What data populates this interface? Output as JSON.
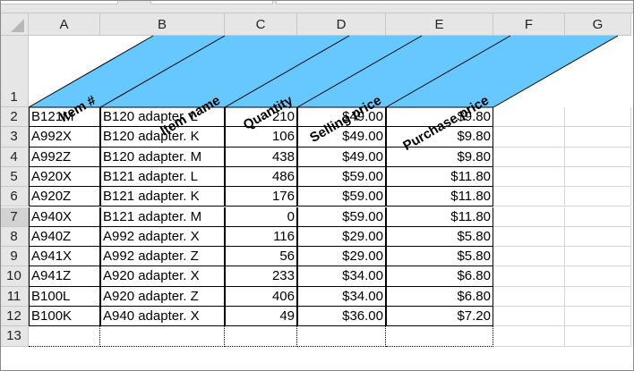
{
  "columns": [
    "A",
    "B",
    "C",
    "D",
    "E",
    "F",
    "G"
  ],
  "rows": [
    "1",
    "2",
    "3",
    "4",
    "5",
    "6",
    "7",
    "8",
    "9",
    "10",
    "11",
    "12",
    "13"
  ],
  "headers": [
    "Item #",
    "Item name",
    "Quantity",
    "Selling price",
    "Purchase price"
  ],
  "header_fill": "#66c8ff",
  "data": [
    [
      "B121M",
      "B120 adapter. L",
      "210",
      "$49.00",
      "$9.80"
    ],
    [
      "A992X",
      "B120 adapter. K",
      "106",
      "$49.00",
      "$9.80"
    ],
    [
      "A992Z",
      "B120 adapter. M",
      "438",
      "$49.00",
      "$9.80"
    ],
    [
      "A920X",
      "B121 adapter. L",
      "486",
      "$59.00",
      "$11.80"
    ],
    [
      "A920Z",
      "B121 adapter. K",
      "176",
      "$59.00",
      "$11.80"
    ],
    [
      "A940X",
      "B121 adapter. M",
      "0",
      "$59.00",
      "$11.80"
    ],
    [
      "A940Z",
      "A992 adapter. X",
      "116",
      "$29.00",
      "$5.80"
    ],
    [
      "A941X",
      "A992 adapter. Z",
      "56",
      "$29.00",
      "$5.80"
    ],
    [
      "A941Z",
      "A920 adapter. X",
      "233",
      "$34.00",
      "$6.80"
    ],
    [
      "B100L",
      "A920 adapter. Z",
      "406",
      "$34.00",
      "$6.80"
    ],
    [
      "B100K",
      "A940 adapter. X",
      "49",
      "$36.00",
      "$7.20"
    ]
  ]
}
